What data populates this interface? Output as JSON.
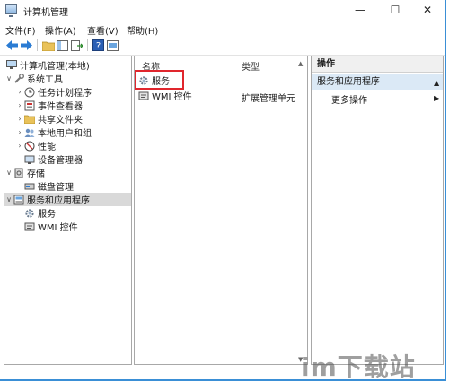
{
  "window": {
    "title": "计算机管理",
    "controls": {
      "minimize": "—",
      "maximize": "☐",
      "close": "✕"
    }
  },
  "menu": [
    "文件(F)",
    "操作(A)",
    "查看(V)",
    "帮助(H)"
  ],
  "toolbar": {
    "icons": [
      "back-arrow-icon",
      "forward-arrow-icon",
      "folder-up-icon",
      "show-tree-icon",
      "export-list-icon",
      "help-icon",
      "console-icon"
    ]
  },
  "tree": {
    "root": "计算机管理(本地)",
    "items": [
      {
        "label": "系统工具",
        "level": 1,
        "expander": "∨"
      },
      {
        "label": "任务计划程序",
        "level": 2,
        "expander": "›"
      },
      {
        "label": "事件查看器",
        "level": 2,
        "expander": "›"
      },
      {
        "label": "共享文件夹",
        "level": 2,
        "expander": "›"
      },
      {
        "label": "本地用户和组",
        "level": 2,
        "expander": "›"
      },
      {
        "label": "性能",
        "level": 2,
        "expander": "›"
      },
      {
        "label": "设备管理器",
        "level": 2,
        "expander": ""
      },
      {
        "label": "存储",
        "level": 1,
        "expander": "∨"
      },
      {
        "label": "磁盘管理",
        "level": 2,
        "expander": ""
      },
      {
        "label": "服务和应用程序",
        "level": 1,
        "expander": "∨",
        "selected": true
      },
      {
        "label": "服务",
        "level": 2,
        "expander": ""
      },
      {
        "label": "WMI 控件",
        "level": 2,
        "expander": ""
      }
    ]
  },
  "list": {
    "columns": [
      "名称",
      "类型"
    ],
    "rows": [
      {
        "name": "服务",
        "type": ""
      },
      {
        "name": "WMI 控件",
        "type": "扩展管理单元"
      }
    ]
  },
  "actions": {
    "header": "操作",
    "group": "服务和应用程序",
    "more": "更多操作"
  },
  "watermark": "im下载站",
  "colors": {
    "highlight_box": "#e0262d",
    "selected_row": "#d9d9d9",
    "action_group": "#dbe9f6",
    "window_border": "#3a8fd6"
  }
}
